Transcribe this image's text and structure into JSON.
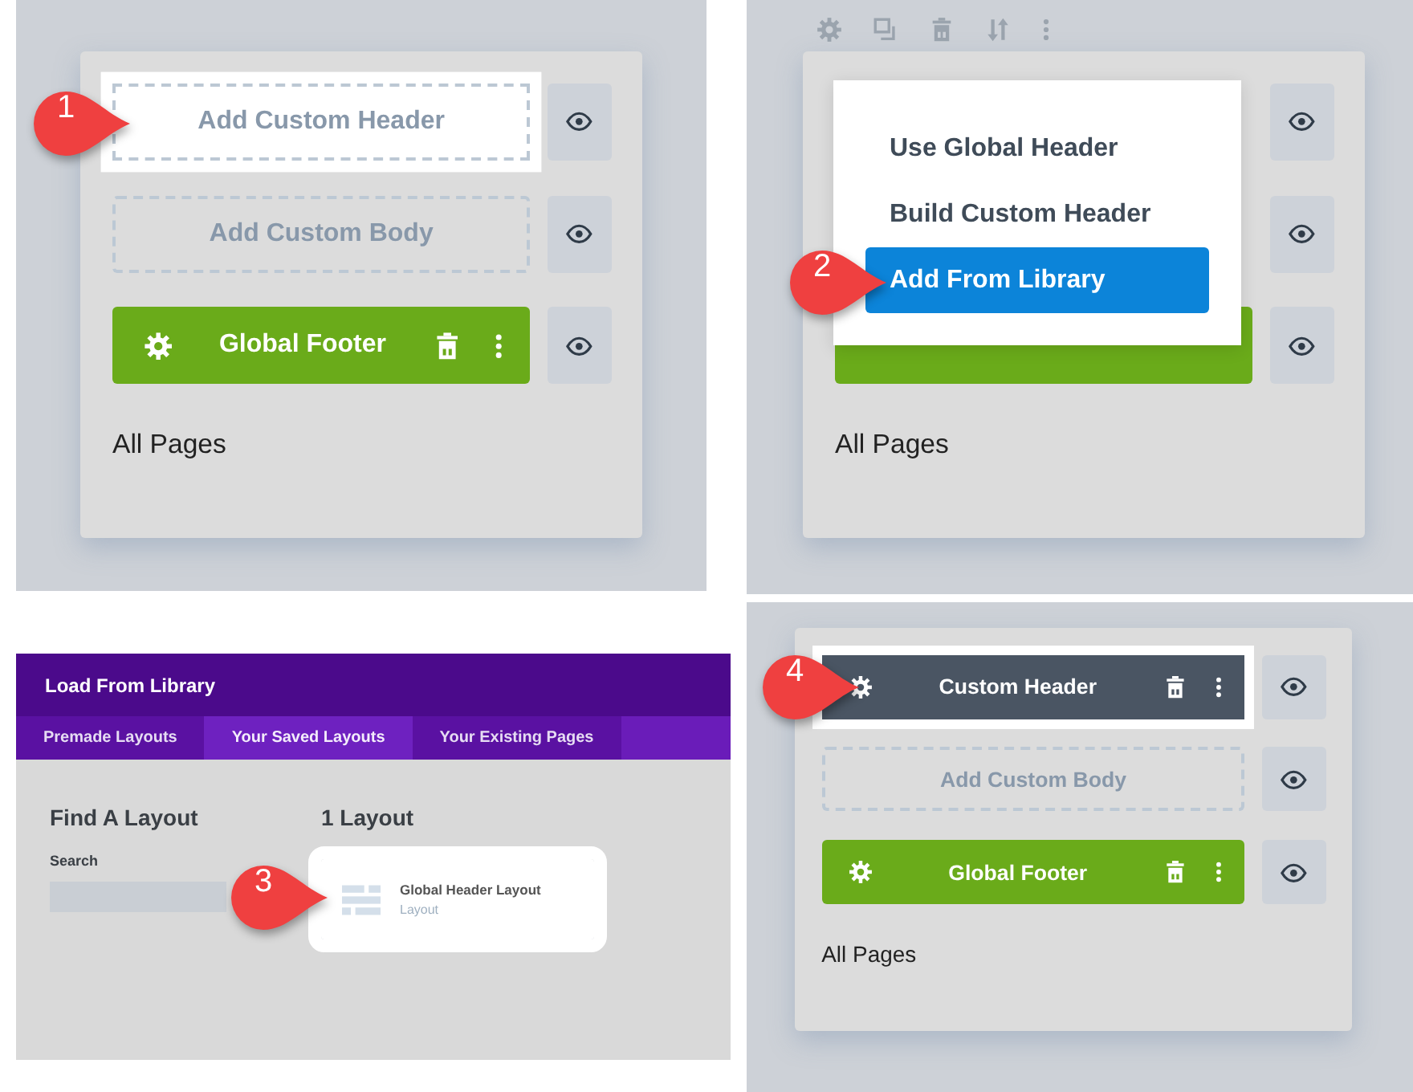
{
  "panels": [
    {
      "kind": "template",
      "callout": "1",
      "toolbar": false,
      "rows": [
        {
          "kind": "placeholder",
          "label": "Add Custom Header",
          "highlighted": true
        },
        {
          "kind": "placeholder",
          "label": "Add Custom Body",
          "highlighted": false
        },
        {
          "kind": "bar",
          "label": "Global Footer",
          "color": "#6aab1a",
          "highlighted": false
        }
      ],
      "caption": "All Pages"
    },
    {
      "kind": "template",
      "callout": "2",
      "toolbar": true,
      "menu": {
        "items": [
          {
            "label": "Use Global Header",
            "selected": false
          },
          {
            "label": "Build Custom Header",
            "selected": false
          },
          {
            "label": "Add From Library",
            "selected": true
          }
        ]
      },
      "rows": [
        {
          "kind": "covered"
        },
        {
          "kind": "covered"
        },
        {
          "kind": "bar",
          "color": "#6aab1a",
          "highlighted": false
        }
      ],
      "caption": "All Pages"
    },
    {
      "kind": "library",
      "callout": "3",
      "title": "Load From Library",
      "tabs": [
        {
          "label": "Premade Layouts",
          "selected": false
        },
        {
          "label": "Your Saved Layouts",
          "selected": true
        },
        {
          "label": "Your Existing Pages",
          "selected": false
        }
      ],
      "filter_heading": "Find A Layout",
      "search": {
        "label": "Search"
      },
      "result_count": "1 Layout",
      "result": {
        "title": "Global Header Layout",
        "type": "Layout",
        "highlighted": true
      }
    },
    {
      "kind": "template",
      "callout": "4",
      "toolbar": false,
      "rows": [
        {
          "kind": "bar",
          "label": "Custom Header",
          "color": "#4a5563",
          "highlighted": true
        },
        {
          "kind": "placeholder",
          "label": "Add Custom Body",
          "highlighted": false
        },
        {
          "kind": "bar",
          "label": "Global Footer",
          "color": "#6aab1a",
          "highlighted": false
        }
      ],
      "caption": "All Pages"
    }
  ]
}
